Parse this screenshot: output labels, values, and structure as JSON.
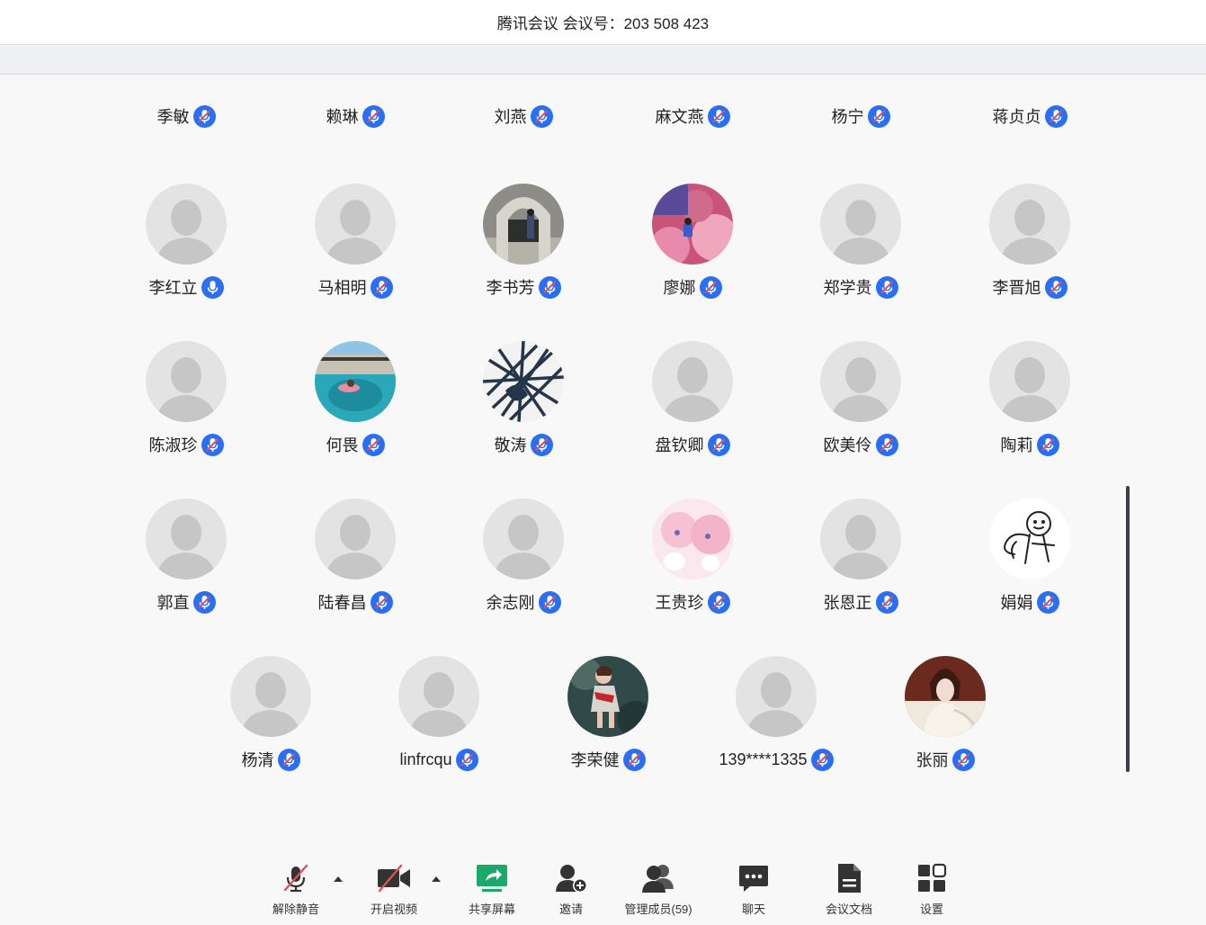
{
  "title": "腾讯会议 会议号：203 508 423",
  "colors": {
    "accent": "#2b6ef6",
    "placeholder_bg": "#e3e3e3",
    "placeholder_fg": "#c6c6c6",
    "muted_slash": "#e05252"
  },
  "participants_top_row": [
    {
      "name": "季敏"
    },
    {
      "name": "赖琳"
    },
    {
      "name": "刘燕"
    },
    {
      "name": "麻文燕"
    },
    {
      "name": "杨宁"
    },
    {
      "name": "蒋贞贞"
    }
  ],
  "rows": [
    [
      {
        "name": "李红立",
        "avatar": "placeholder",
        "mic": "on"
      },
      {
        "name": "马相明",
        "avatar": "placeholder",
        "mic": "muted"
      },
      {
        "name": "李书芳",
        "avatar": "photo-arch",
        "mic": "muted"
      },
      {
        "name": "廖娜",
        "avatar": "photo-flowers",
        "mic": "muted"
      },
      {
        "name": "郑学贵",
        "avatar": "placeholder",
        "mic": "muted"
      },
      {
        "name": "李晋旭",
        "avatar": "placeholder",
        "mic": "muted"
      }
    ],
    [
      {
        "name": "陈淑珍",
        "avatar": "placeholder",
        "mic": "muted"
      },
      {
        "name": "何畏",
        "avatar": "photo-pool",
        "mic": "muted"
      },
      {
        "name": "敬涛",
        "avatar": "photo-lines",
        "mic": "muted"
      },
      {
        "name": "盘钦卿",
        "avatar": "placeholder",
        "mic": "muted"
      },
      {
        "name": "欧美伶",
        "avatar": "placeholder",
        "mic": "muted"
      },
      {
        "name": "陶莉",
        "avatar": "placeholder",
        "mic": "muted"
      }
    ],
    [
      {
        "name": "郭直",
        "avatar": "placeholder",
        "mic": "muted"
      },
      {
        "name": "陆春昌",
        "avatar": "placeholder",
        "mic": "muted"
      },
      {
        "name": "余志刚",
        "avatar": "placeholder",
        "mic": "muted"
      },
      {
        "name": "王贵珍",
        "avatar": "photo-anime",
        "mic": "muted"
      },
      {
        "name": "张恩正",
        "avatar": "placeholder",
        "mic": "muted"
      },
      {
        "name": "娟娟",
        "avatar": "photo-doodle",
        "mic": "muted"
      }
    ],
    [
      {
        "name": "杨清",
        "avatar": "placeholder",
        "mic": "muted"
      },
      {
        "name": "linfrcqu",
        "avatar": "placeholder",
        "mic": "muted"
      },
      {
        "name": "李荣健",
        "avatar": "photo-girl",
        "mic": "muted"
      },
      {
        "name": "139****1335",
        "avatar": "placeholder",
        "mic": "muted"
      },
      {
        "name": "张丽",
        "avatar": "photo-lady",
        "mic": "muted"
      }
    ]
  ],
  "toolbar": [
    {
      "id": "unmute",
      "label": "解除静音",
      "icon": "mic-muted-icon"
    },
    {
      "id": "video",
      "label": "开启视频",
      "icon": "camera-off-icon"
    },
    {
      "id": "share",
      "label": "共享屏幕",
      "icon": "share-screen-icon"
    },
    {
      "id": "invite",
      "label": "邀请",
      "icon": "invite-user-icon"
    },
    {
      "id": "members",
      "label": "管理成员(59)",
      "icon": "members-icon"
    },
    {
      "id": "chat",
      "label": "聊天",
      "icon": "chat-icon"
    },
    {
      "id": "docs",
      "label": "会议文档",
      "icon": "document-icon"
    },
    {
      "id": "settings",
      "label": "设置",
      "icon": "settings-grid-icon"
    }
  ]
}
